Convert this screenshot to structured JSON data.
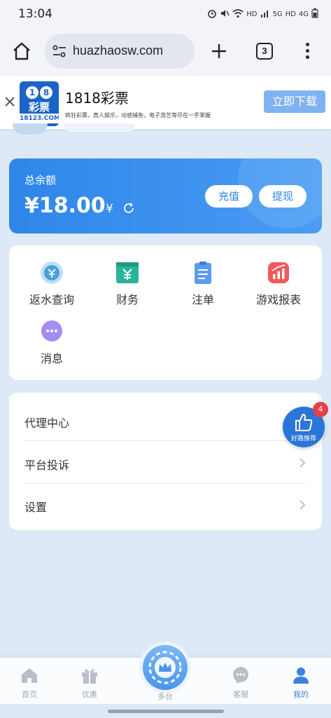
{
  "status_bar": {
    "time": "13:04",
    "indicators": [
      "HD",
      "5G",
      "HD",
      "4G"
    ]
  },
  "browser": {
    "url": "huazhaosw.com",
    "tab_count": "3"
  },
  "ad": {
    "logo_text": "彩票",
    "logo_domain": "18123.COM",
    "title": "1818彩票",
    "subtitle": "疯狂彩票，真人娱乐，动感捕鱼，电子游艺等尽在一手掌握",
    "download_label": "立即下载"
  },
  "balance": {
    "label": "总余额",
    "amount": "¥18.00",
    "unit": "¥",
    "recharge_label": "充值",
    "withdraw_label": "提现"
  },
  "functions": [
    {
      "label": "返水查询",
      "icon": "rebate-icon",
      "color": "#4aa0d8"
    },
    {
      "label": "财务",
      "icon": "finance-icon",
      "color": "#29b59a"
    },
    {
      "label": "注单",
      "icon": "betslip-icon",
      "color": "#5b9bf0"
    },
    {
      "label": "游戏报表",
      "icon": "report-icon",
      "color": "#ef5a5a"
    },
    {
      "label": "消息",
      "icon": "message-icon",
      "color": "#8a6cf0"
    }
  ],
  "menu": [
    {
      "label": "代理中心"
    },
    {
      "label": "平台投诉"
    },
    {
      "label": "设置"
    }
  ],
  "float_recommend": {
    "label": "好路推荐",
    "badge": "4"
  },
  "bottom_nav": [
    {
      "label": "首页",
      "icon": "home-icon"
    },
    {
      "label": "优惠",
      "icon": "gift-icon"
    },
    {
      "label": "多台",
      "icon": "crown-icon"
    },
    {
      "label": "客服",
      "icon": "chat-icon"
    },
    {
      "label": "我的",
      "icon": "user-icon"
    }
  ],
  "colors": {
    "primary": "#2e86e8",
    "background": "#dde9f6",
    "nav_active": "#3b82e0",
    "badge": "#e6404a"
  }
}
